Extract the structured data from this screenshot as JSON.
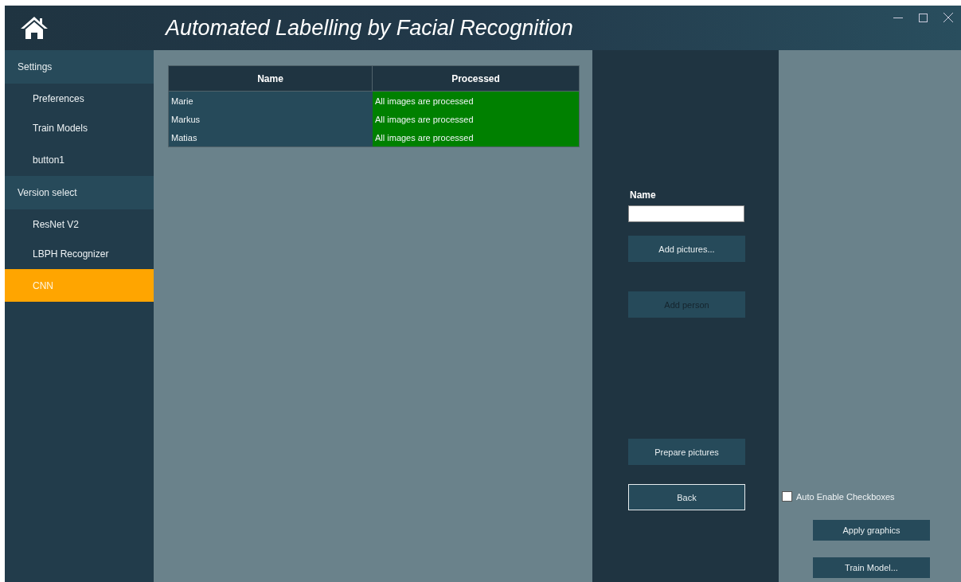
{
  "window": {
    "title": "Automated Labelling by Facial Recognition"
  },
  "sidebar": {
    "sections": [
      {
        "header": "Settings",
        "items": [
          {
            "label": "Preferences",
            "selected": false
          },
          {
            "label": "Train Models",
            "selected": false
          },
          {
            "label": "button1",
            "selected": false
          }
        ]
      },
      {
        "header": "Version select",
        "items": [
          {
            "label": "ResNet V2",
            "selected": false
          },
          {
            "label": "LBPH Recognizer",
            "selected": false
          },
          {
            "label": "CNN",
            "selected": true
          }
        ]
      }
    ]
  },
  "table": {
    "columns": [
      "Name",
      "Processed"
    ],
    "rows": [
      {
        "name": "Marie",
        "processed": "All images are processed"
      },
      {
        "name": "Markus",
        "processed": "All images are processed"
      },
      {
        "name": "Matias",
        "processed": "All images are processed"
      }
    ]
  },
  "person_panel": {
    "name_label": "Name",
    "buttons": [
      {
        "label": "Add pictures...",
        "disabled": false,
        "kind": "filled"
      },
      {
        "label": "Add person",
        "disabled": true,
        "kind": "filled"
      },
      {
        "label": "Prepare pictures",
        "disabled": false,
        "kind": "filled"
      },
      {
        "label": "Back",
        "disabled": false,
        "kind": "outlined"
      }
    ]
  },
  "options": {
    "checkbox": {
      "label": "Auto Enable Checkboxes",
      "checked": false
    },
    "buttons": [
      {
        "label": "Apply graphics"
      },
      {
        "label": "Train Model..."
      }
    ]
  }
}
